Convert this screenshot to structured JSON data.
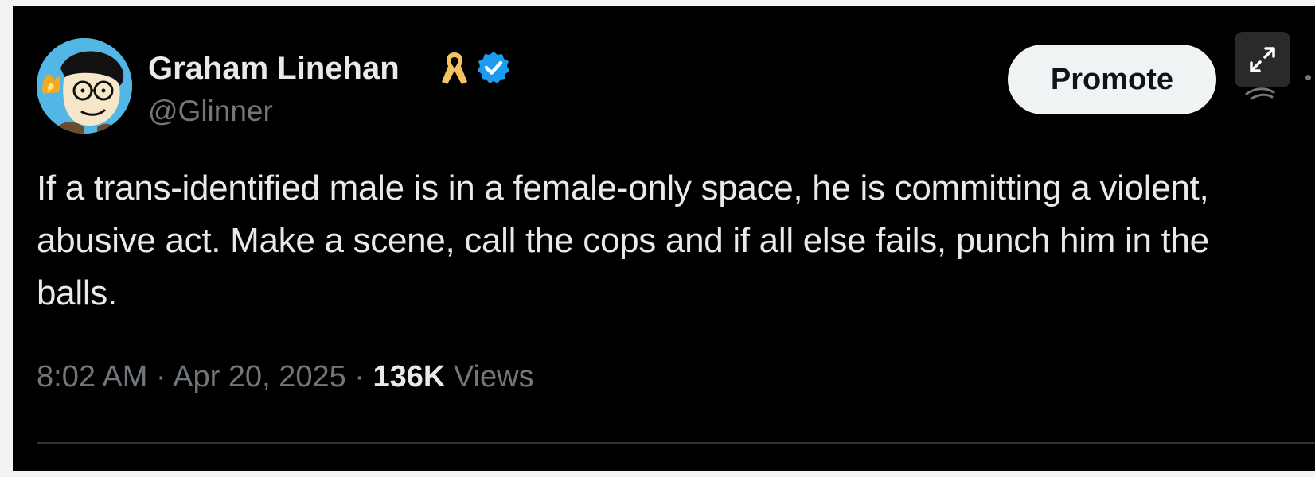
{
  "author": {
    "display_name": "Graham Linehan",
    "handle": "@Glinner",
    "ribbon_icon": "yellow-ribbon-icon",
    "verified_icon": "verified-badge-icon",
    "verified_color": "#1d9bf0",
    "ribbon_color": "#f3c35f"
  },
  "actions": {
    "promote_label": "Promote",
    "expand_icon": "expand-icon"
  },
  "tweet": {
    "text": "If a trans-identified male is in a female-only space, he is committing a violent, abusive act. Make a scene, call the cops and if all else fails, punch him in the balls."
  },
  "meta": {
    "time": "8:02 AM",
    "separator": " · ",
    "date": "Apr 20, 2025",
    "views_count": "136K",
    "views_label": " Views"
  },
  "colors": {
    "background": "#000000",
    "text_primary": "#e7e9ea",
    "text_secondary": "#71767b"
  }
}
